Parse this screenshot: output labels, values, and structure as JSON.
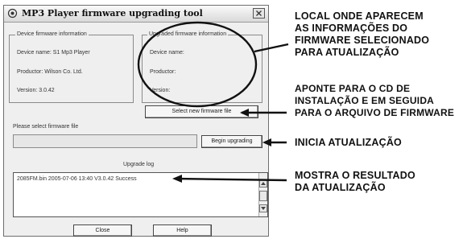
{
  "window": {
    "title": "MP3 Player firmware upgrading tool"
  },
  "device_group": {
    "title": "Device firmware information",
    "name_line": "Device name: S1 Mp3 Player",
    "productor_line": "Productor: Wilson Co. Ltd.",
    "version_line": "Version: 3.0.42"
  },
  "upgraded_group": {
    "title": "Upgraded firmware information",
    "name_line": "Device name:",
    "productor_line": "Productor:",
    "version_line": "Version:"
  },
  "select_button": "Select new firmware file",
  "file_prompt": "Please select firmware file",
  "file_field_value": "",
  "begin_button": "Begin upgrading",
  "log": {
    "title": "Upgrade log",
    "entries": [
      "2085FM.bin  2005-07-06  13:40  V3.0.42  Success"
    ]
  },
  "close_button": "Close",
  "help_button": "Help",
  "annotations": {
    "a1": [
      "LOCAL ONDE APARECEM",
      "AS INFORMAÇÕES DO",
      "FIRMWARE SELECIONADO",
      "PARA ATUALIZAÇÃO"
    ],
    "a2": [
      "APONTE PARA O CD DE",
      "INSTALAÇÃO E EM SEGUIDA",
      "PARA O ARQUIVO DE FIRMWARE"
    ],
    "a3": [
      "INICIA ATUALIZAÇÃO"
    ],
    "a4": [
      "MOSTRA O RESULTADO",
      "DA ATUALIZAÇÃO"
    ]
  }
}
